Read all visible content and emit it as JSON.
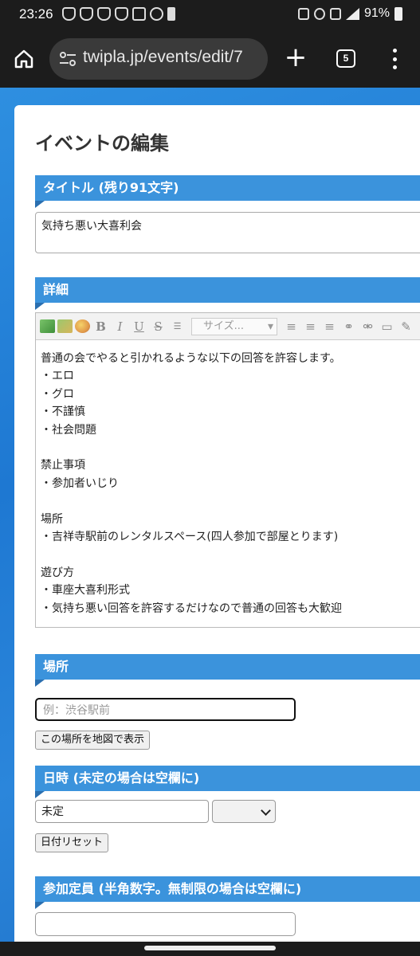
{
  "status_bar": {
    "time": "23:26",
    "battery": "91%"
  },
  "browser": {
    "url": "twipla.jp/events/edit/7",
    "tab_count": "5"
  },
  "page": {
    "title": "イベントの編集",
    "title_section": {
      "header": "タイトル (残り91文字)",
      "value": "気持ち悪い大喜利会"
    },
    "details_section": {
      "header": "詳細",
      "size_label": "サイズ...",
      "body": "普通の会でやると引かれるような以下の回答を許容します。\n・エロ\n・グロ\n・不謹慎\n・社会問題\n\n禁止事項\n・参加者いじり\n\n場所\n・吉祥寺駅前のレンタルスペース(四人参加で部屋とります)\n\n遊び方\n・車座大喜利形式\n・気持ち悪い回答を許容するだけなので普通の回答も大歓迎"
    },
    "place_section": {
      "header": "場所",
      "placeholder": "例：渋谷駅前",
      "map_button": "この場所を地図で表示"
    },
    "date_section": {
      "header": "日時 (未定の場合は空欄に)",
      "value": "未定",
      "reset_button": "日付リセット"
    },
    "capacity_section": {
      "header": "参加定員 (半角数字。無制限の場合は空欄に)"
    }
  }
}
